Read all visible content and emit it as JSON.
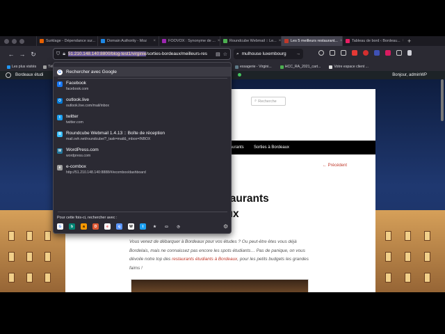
{
  "tabs": [
    {
      "label": "Surklage - Dépendance sur...",
      "color": "#e66000",
      "active": false
    },
    {
      "label": "Domain Authority - Moz",
      "color": "#1e88e5",
      "active": false
    },
    {
      "label": "FOOVOX : Synonyme de ...",
      "color": "#9c27b0",
      "active": false
    },
    {
      "label": "Roundcube Webmail :: Le...",
      "color": "#4caf50",
      "active": false
    },
    {
      "label": "Les 5 meilleurs restaurant...",
      "color": "#c0392b",
      "active": true
    },
    {
      "label": "Tableau de bord ‹ Bordeau...",
      "color": "#e91e63",
      "active": false
    }
  ],
  "address_bar": {
    "url_selected": "51.210.148.140:8800/blog-test1/virginie",
    "url_rest": "/sorties-bordeaux/meilleurs-res"
  },
  "search_bar": {
    "value": "mulhouse luxembourg"
  },
  "bookmarks": {
    "left": [
      {
        "label": "Les plus visités",
        "color": "#2196f3"
      },
      {
        "label": "Tél",
        "color": "#9e9e9e"
      }
    ],
    "right": [
      {
        "label": "essagerie - Virgini...",
        "color": "#607d8b"
      },
      {
        "label": "HCC_RA_2021_cart...",
        "color": "#4caf50"
      },
      {
        "label": "Votre espace client ...",
        "color": "#e0e0e0"
      }
    ]
  },
  "wp_admin_bar": {
    "site": "Bordeaux étudi",
    "greeting": "Bonjour, adminWP"
  },
  "dropdown": {
    "search_with": "Rechercher avec Google",
    "items": [
      {
        "title": "Facebook",
        "url": "facebook.com",
        "icon": "facebook-icon",
        "color": "#1877f2",
        "glyph": "f"
      },
      {
        "title": "outlook.live",
        "url": "outlook.live.com/mail/inbox",
        "icon": "outlook-icon",
        "color": "#0078d4",
        "glyph": "O"
      },
      {
        "title": "twitter",
        "url": "twitter.com",
        "icon": "twitter-icon",
        "color": "#1da1f2",
        "glyph": "t"
      },
      {
        "title": "Roundcube Webmail 1.4.13 :: Boîte de réception",
        "url": "mail.ovh.net/roundcube/?_task=mail&_mbox=INBOX",
        "icon": "roundcube-icon",
        "color": "#37beff",
        "glyph": "R"
      },
      {
        "title": "WordPress.com",
        "url": "wordpress.com",
        "icon": "wordpress-icon",
        "color": "#21759b",
        "glyph": "W"
      },
      {
        "title": "e-combox",
        "url": "http://51.210.148.140:8888/#/ecombox/dashboard",
        "icon": "ecombox-icon",
        "color": "#9e9e9e",
        "glyph": "e"
      }
    ],
    "footer_label": "Pour cette fois-ci, rechercher avec :",
    "engines": [
      {
        "icon": "google-icon",
        "color": "#ffffff",
        "glyph": "G",
        "fg": "#4285f4"
      },
      {
        "icon": "bing-icon",
        "color": "#008373",
        "glyph": "b",
        "fg": "#ffffff"
      },
      {
        "icon": "amazon-icon",
        "color": "#ff9900",
        "glyph": "a",
        "fg": "#000000"
      },
      {
        "icon": "duckduckgo-icon",
        "color": "#de5833",
        "glyph": "D",
        "fg": "#ffffff"
      },
      {
        "icon": "ebay-icon",
        "color": "#ffffff",
        "glyph": "e",
        "fg": "#e53238"
      },
      {
        "icon": "qwant-icon",
        "color": "#5c97ff",
        "glyph": "q",
        "fg": "#ffffff"
      },
      {
        "icon": "wikipedia-icon",
        "color": "#ffffff",
        "glyph": "W",
        "fg": "#000000"
      },
      {
        "icon": "twitter-search-icon",
        "color": "#1da1f2",
        "glyph": "t",
        "fg": "#ffffff"
      },
      {
        "icon": "bookmarks-icon",
        "color": "#2b2a33",
        "glyph": "★",
        "fg": "#e0e0e6"
      },
      {
        "icon": "tabs-icon",
        "color": "#2b2a33",
        "glyph": "▭",
        "fg": "#e0e0e6"
      },
      {
        "icon": "history-icon",
        "color": "#2b2a33",
        "glyph": "◷",
        "fg": "#e0e0e6"
      }
    ]
  },
  "page": {
    "search_placeholder": "Recherche",
    "nav_items": [
      "staurants",
      "Sorties à Bordeaux"
    ],
    "previous_link": "← Précédent",
    "title": "Les 5 meilleurs restaurants étudiants à Bordeaux",
    "intro_before": "Vous venez de débarquer à Bordeaux pour vos études ? Ou peut-être êtes vous déjà Bordelais, mais ne connaissez pas encore les spots étudiants… Pas de panique, on vous dévoile notre top des ",
    "intro_link": "restaurants étudiants à Bordeaux",
    "intro_after": ", pour les petits budgets les grandes faims !"
  }
}
